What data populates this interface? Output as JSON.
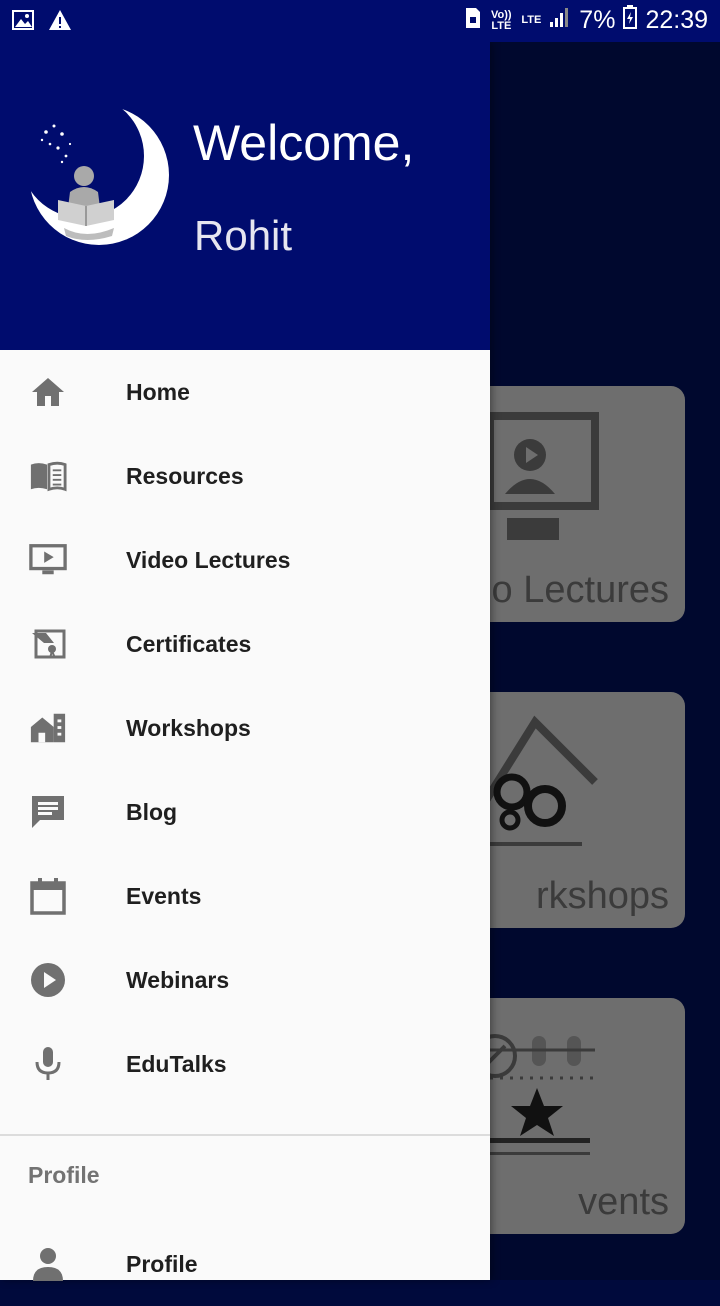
{
  "status_bar": {
    "volte_label": "Vo)) LTE",
    "lte_label": "LTE",
    "battery": "7%",
    "time": "22:39",
    "icons": [
      "image-icon",
      "warning-icon",
      "lock-sim-icon",
      "volte-icon",
      "lte-icon",
      "signal-icon",
      "battery-icon"
    ]
  },
  "drawer": {
    "header": {
      "welcome": "Welcome,",
      "username": "Rohit",
      "background_color": "#000c6e"
    },
    "items": [
      {
        "label": "Home",
        "icon": "home-icon"
      },
      {
        "label": "Resources",
        "icon": "book-icon"
      },
      {
        "label": "Video Lectures",
        "icon": "video-screen-icon"
      },
      {
        "label": "Certificates",
        "icon": "certificate-icon"
      },
      {
        "label": "Workshops",
        "icon": "building-icon"
      },
      {
        "label": "Blog",
        "icon": "chat-icon"
      },
      {
        "label": "Events",
        "icon": "calendar-icon"
      },
      {
        "label": "Webinars",
        "icon": "play-circle-icon"
      },
      {
        "label": "EduTalks",
        "icon": "microphone-icon"
      }
    ],
    "section_profile": "Profile",
    "profile_item": {
      "label": "Profile",
      "icon": "person-icon"
    }
  },
  "background_cards": [
    {
      "label": "o Lectures"
    },
    {
      "label": "rkshops"
    },
    {
      "label": "vents"
    }
  ]
}
